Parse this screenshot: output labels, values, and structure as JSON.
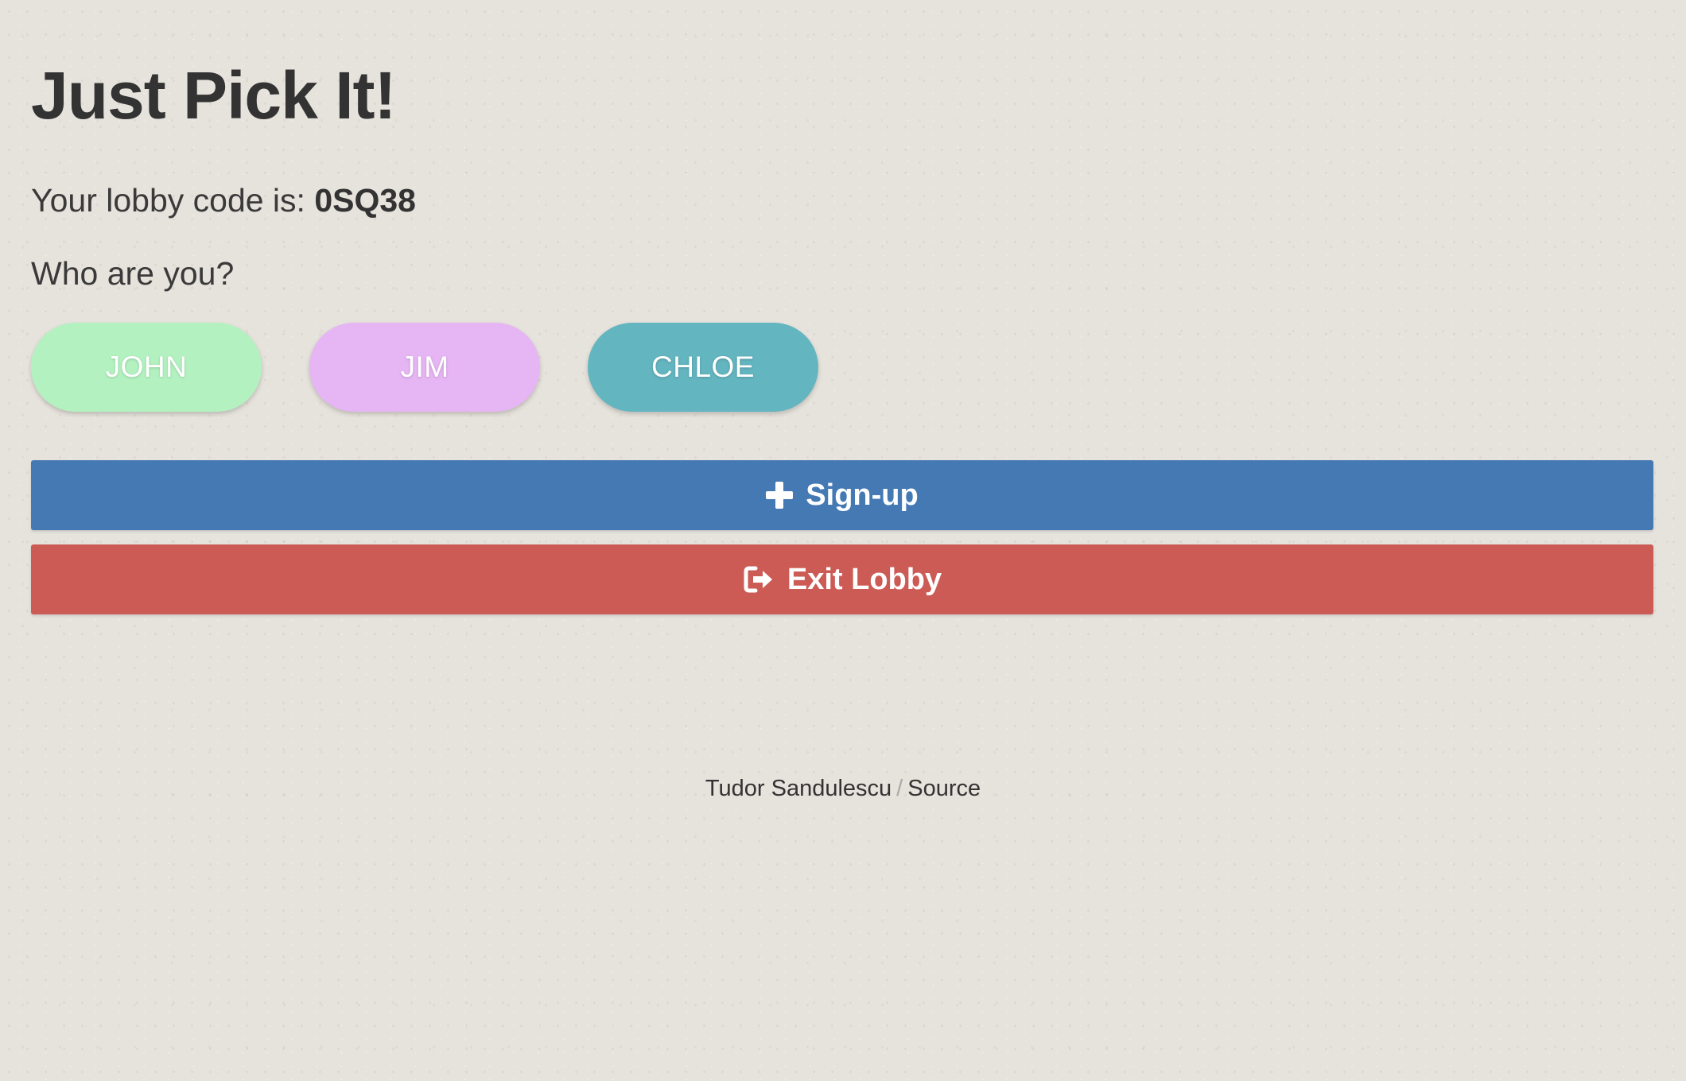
{
  "page": {
    "title": "Just Pick It!"
  },
  "lobby": {
    "prefix": "Your lobby code is: ",
    "code": "0SQ38"
  },
  "prompt": "Who are you?",
  "players": [
    {
      "name": "JOHN",
      "color": "#b3f2c0"
    },
    {
      "name": "JIM",
      "color": "#e6b5f3"
    },
    {
      "name": "CHLOE",
      "color": "#63b5c0"
    }
  ],
  "actions": {
    "signup_label": "Sign-up",
    "signup_icon": "plus-icon",
    "signup_color": "#4479b3",
    "exit_label": "Exit Lobby",
    "exit_icon": "sign-out-icon",
    "exit_color": "#cc5b55"
  },
  "footer": {
    "author": "Tudor Sandulescu",
    "separator": "/",
    "source_label": "Source"
  }
}
